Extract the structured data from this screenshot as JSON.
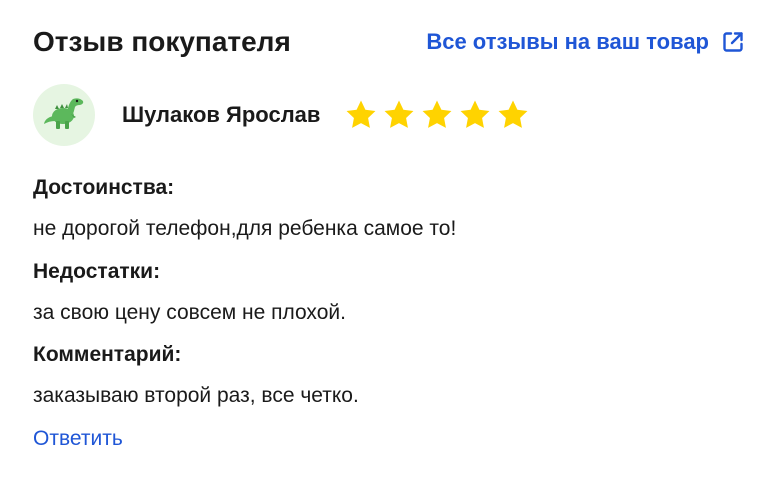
{
  "header": {
    "title": "Отзыв покупателя",
    "all_reviews_label": "Все отзывы на ваш товар",
    "external_icon": "external-link-icon"
  },
  "author": {
    "avatar_icon": "dinosaur-icon",
    "name": "Шулаков Ярослав",
    "rating": 5,
    "rating_max": 5,
    "star_color": "#ffd300"
  },
  "review": {
    "pros_label": "Достоинства:",
    "pros_text": "не дорогой телефон,для ребенка самое то!",
    "cons_label": "Недостатки:",
    "cons_text": "за свою цену совсем не плохой.",
    "comment_label": "Комментарий:",
    "comment_text": "заказываю второй раз, все четко."
  },
  "actions": {
    "reply_label": "Ответить"
  },
  "colors": {
    "link": "#1f56d6",
    "text": "#1a1a1a",
    "avatar_bg": "#e6f5e2"
  }
}
